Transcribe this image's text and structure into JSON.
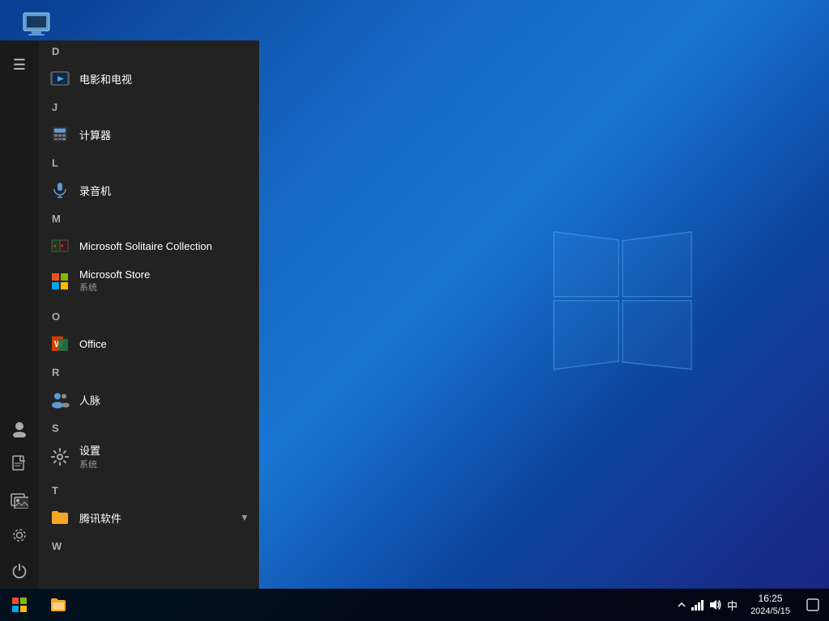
{
  "desktop": {
    "icon": {
      "label": "此电脑"
    }
  },
  "start_menu": {
    "sections": [
      {
        "letter": "D",
        "apps": [
          {
            "name": "电影和电视",
            "icon_type": "film",
            "sub": ""
          }
        ]
      },
      {
        "letter": "J",
        "apps": [
          {
            "name": "计算器",
            "icon_type": "calc",
            "sub": ""
          }
        ]
      },
      {
        "letter": "L",
        "apps": [
          {
            "name": "录音机",
            "icon_type": "mic",
            "sub": ""
          }
        ]
      },
      {
        "letter": "M",
        "apps": [
          {
            "name": "Microsoft Solitaire Collection",
            "icon_type": "cards",
            "sub": ""
          },
          {
            "name": "Microsoft Store",
            "icon_type": "store",
            "sub": "系统"
          }
        ]
      },
      {
        "letter": "O",
        "apps": [
          {
            "name": "Office",
            "icon_type": "office",
            "sub": ""
          }
        ]
      },
      {
        "letter": "R",
        "apps": [
          {
            "name": "人脉",
            "icon_type": "people",
            "sub": ""
          }
        ]
      },
      {
        "letter": "S",
        "apps": [
          {
            "name": "设置",
            "icon_type": "settings",
            "sub": "系统"
          }
        ]
      },
      {
        "letter": "T",
        "apps": [
          {
            "name": "腾讯软件",
            "icon_type": "folder",
            "sub": "",
            "has_arrow": true
          }
        ]
      },
      {
        "letter": "W",
        "apps": []
      }
    ]
  },
  "sidebar": {
    "icons": [
      {
        "name": "hamburger-menu",
        "symbol": "☰"
      },
      {
        "name": "user-icon",
        "symbol": "👤"
      },
      {
        "name": "document-icon",
        "symbol": "📄"
      },
      {
        "name": "photos-icon",
        "symbol": "🖼"
      },
      {
        "name": "settings-icon",
        "symbol": "⚙"
      },
      {
        "name": "power-icon",
        "symbol": "⏻"
      }
    ]
  },
  "taskbar": {
    "start_label": "⊞",
    "time": "16:25",
    "date": "2024/5/15",
    "language": "中",
    "icons": [
      "^",
      "🔊",
      "📶"
    ],
    "notification": "🗨"
  }
}
